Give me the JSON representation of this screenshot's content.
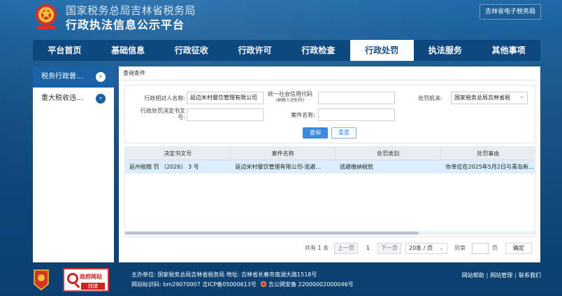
{
  "header": {
    "org_name": "国家税务总局吉林省税务局",
    "platform_title": "行政执法信息公示平台",
    "etax_label": "吉林省电子税务局"
  },
  "nav": {
    "items": [
      "平台首页",
      "基础信息",
      "行政征收",
      "行政许可",
      "行政检查",
      "行政处罚",
      "执法服务",
      "其他事项"
    ],
    "active": "行政处罚"
  },
  "sidebar": {
    "items": [
      "税务行政普...",
      "重大税收违..."
    ]
  },
  "query": {
    "panel_title": "查询条件",
    "party_label": "行政相对人名称:",
    "party_value": "延边米村餐饮管理有限公司",
    "credit_label_line1": "统一社会信用代码",
    "credit_label_line2": "(纳税人识别号)",
    "credit_value": "",
    "agency_label": "处罚机关:",
    "agency_value": "国家税务总局吉林省税",
    "decision_label_line1": "行政处罚决定书文",
    "decision_label_line2": "号:",
    "decision_value": "",
    "case_label": "案件名称:",
    "case_value": "",
    "search_btn": "查询",
    "reset_btn": "重置"
  },
  "table": {
    "headers": [
      "决定书文号",
      "案件名称",
      "处罚类别",
      "处罚事由"
    ],
    "rows": [
      [
        "延州税稽 罚 〔2026〕 3 号",
        "延边米村餐饮管理有限公司-逃避...",
        "逃避缴纳税款",
        "你单位在2025年5月2日与青岛新..."
      ]
    ]
  },
  "pager": {
    "total_prefix": "共有",
    "total_count": "1",
    "total_suffix": "条",
    "prev_label": "上一页",
    "current_page": "1",
    "next_label": "下一页",
    "page_size": "20条 / 页",
    "goto_label": "到第",
    "page_unit": "页",
    "confirm_label": "确定"
  },
  "footer": {
    "sponsor": "主办单位:  国家税务总局吉林省税务局     地址:  吉林省长春市南湖大路1518号",
    "site_id": "网站标识码:  bm29070007   吉ICP备05000613号",
    "police_record": "吉公网安备 22000002000046号",
    "gov_site_title": "政府网站",
    "gov_site_sub": "找错",
    "links": [
      "网站帮助",
      "网站管理",
      "联系我们"
    ]
  }
}
